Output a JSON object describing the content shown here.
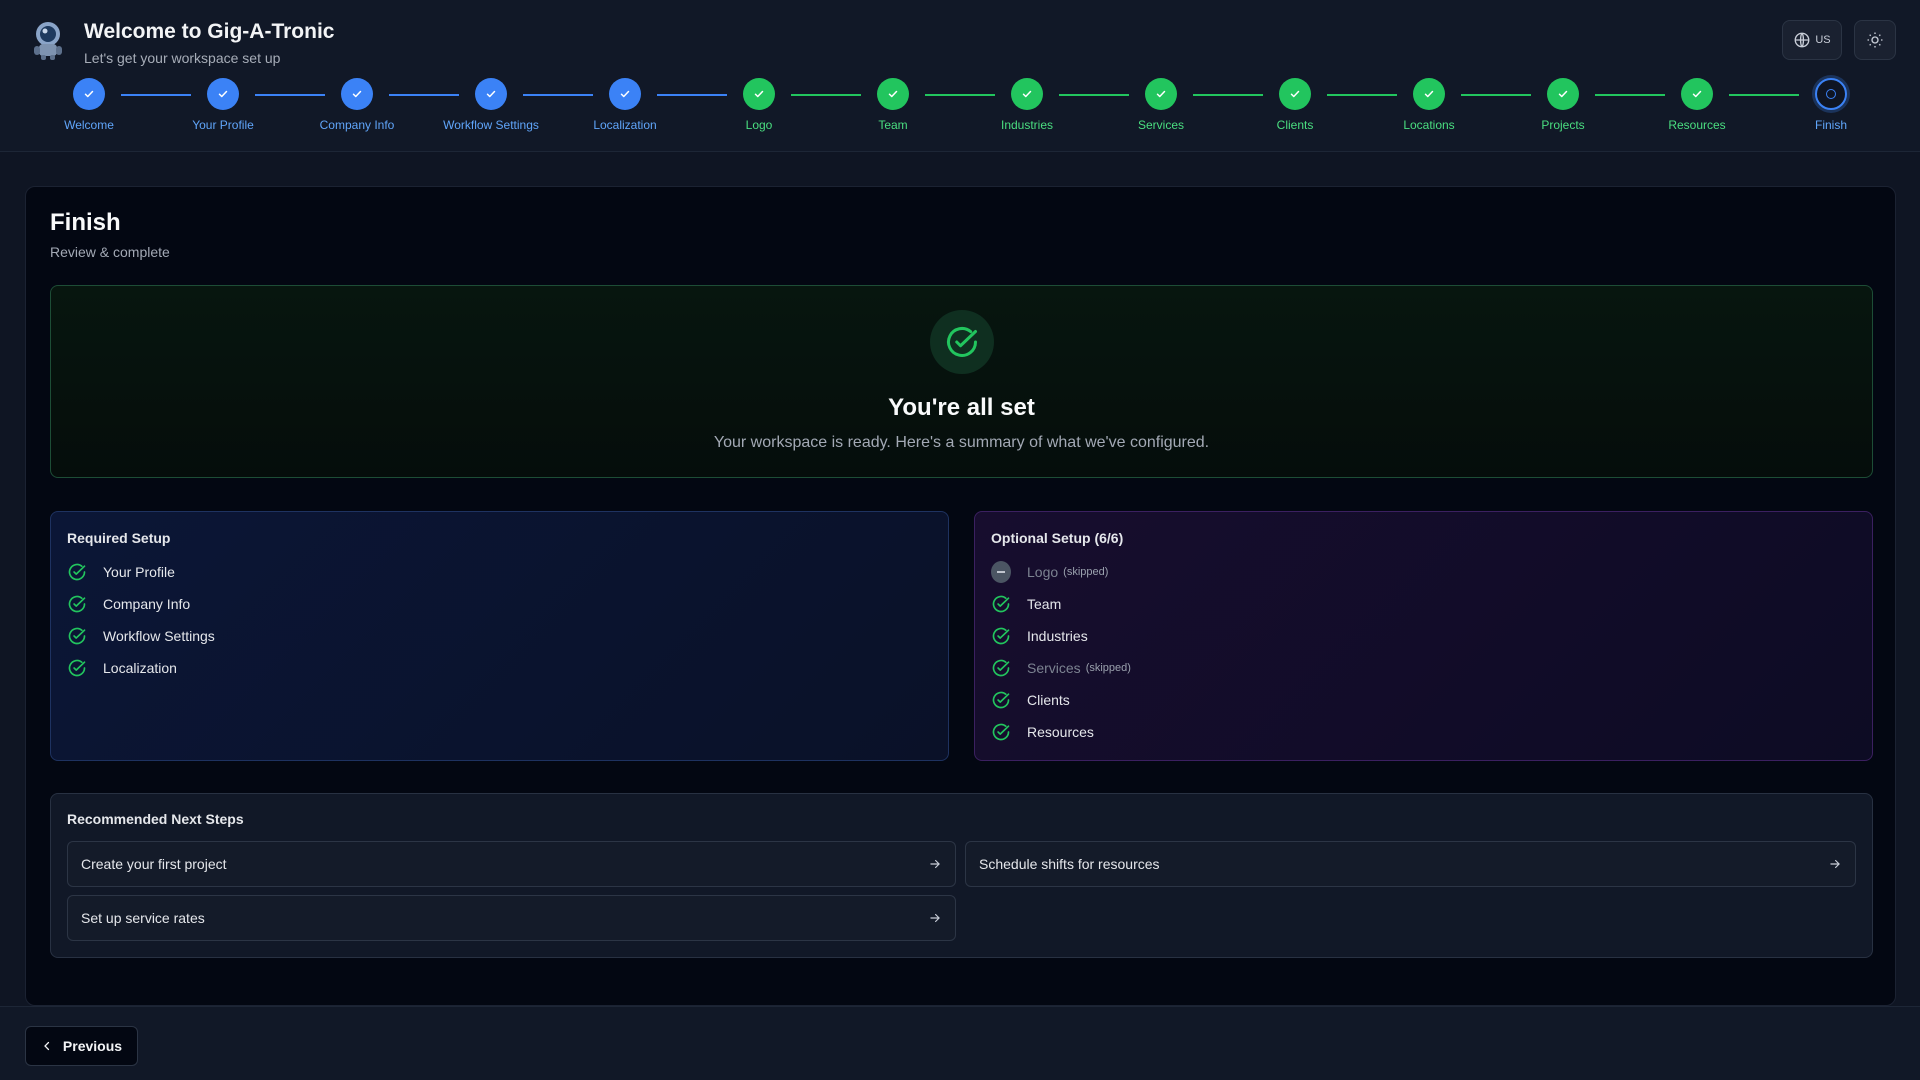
{
  "app": {
    "title": "Welcome to Gig-A-Tronic",
    "subtitle": "Let's get your workspace set up",
    "language_label": "US"
  },
  "colors": {
    "accent_blue": "#3b82f6",
    "success_green": "#22c55e",
    "background": "#0f1523"
  },
  "steps": [
    {
      "label": "Welcome",
      "state": "done",
      "color": "blue"
    },
    {
      "label": "Your Profile",
      "state": "done",
      "color": "blue"
    },
    {
      "label": "Company Info",
      "state": "done",
      "color": "blue"
    },
    {
      "label": "Workflow Settings",
      "state": "done",
      "color": "blue"
    },
    {
      "label": "Localization",
      "state": "done",
      "color": "blue"
    },
    {
      "label": "Logo",
      "state": "done",
      "color": "green"
    },
    {
      "label": "Team",
      "state": "done",
      "color": "green"
    },
    {
      "label": "Industries",
      "state": "done",
      "color": "green"
    },
    {
      "label": "Services",
      "state": "done",
      "color": "green"
    },
    {
      "label": "Clients",
      "state": "done",
      "color": "green"
    },
    {
      "label": "Locations",
      "state": "done",
      "color": "green"
    },
    {
      "label": "Projects",
      "state": "done",
      "color": "green"
    },
    {
      "label": "Resources",
      "state": "done",
      "color": "green"
    },
    {
      "label": "Finish",
      "state": "current",
      "color": "blue"
    }
  ],
  "page": {
    "title": "Finish",
    "subtitle": "Review & complete"
  },
  "hero": {
    "title": "You're all set",
    "subtitle": "Your workspace is ready. Here's a summary of what we've configured."
  },
  "required": {
    "title": "Required Setup",
    "items": [
      {
        "label": "Your Profile",
        "status": "done"
      },
      {
        "label": "Company Info",
        "status": "done"
      },
      {
        "label": "Workflow Settings",
        "status": "done"
      },
      {
        "label": "Localization",
        "status": "done"
      }
    ]
  },
  "optional": {
    "title": "Optional Setup (6/6)",
    "skipped_label": "(skipped)",
    "items": [
      {
        "label": "Logo",
        "status": "skipped-dash"
      },
      {
        "label": "Team",
        "status": "done"
      },
      {
        "label": "Industries",
        "status": "done"
      },
      {
        "label": "Services",
        "status": "skipped-check"
      },
      {
        "label": "Clients",
        "status": "done"
      },
      {
        "label": "Resources",
        "status": "done"
      }
    ]
  },
  "next_steps": {
    "title": "Recommended Next Steps",
    "items": [
      {
        "label": "Create your first project"
      },
      {
        "label": "Schedule shifts for resources"
      },
      {
        "label": "Set up service rates"
      }
    ]
  },
  "footer": {
    "previous_label": "Previous"
  }
}
